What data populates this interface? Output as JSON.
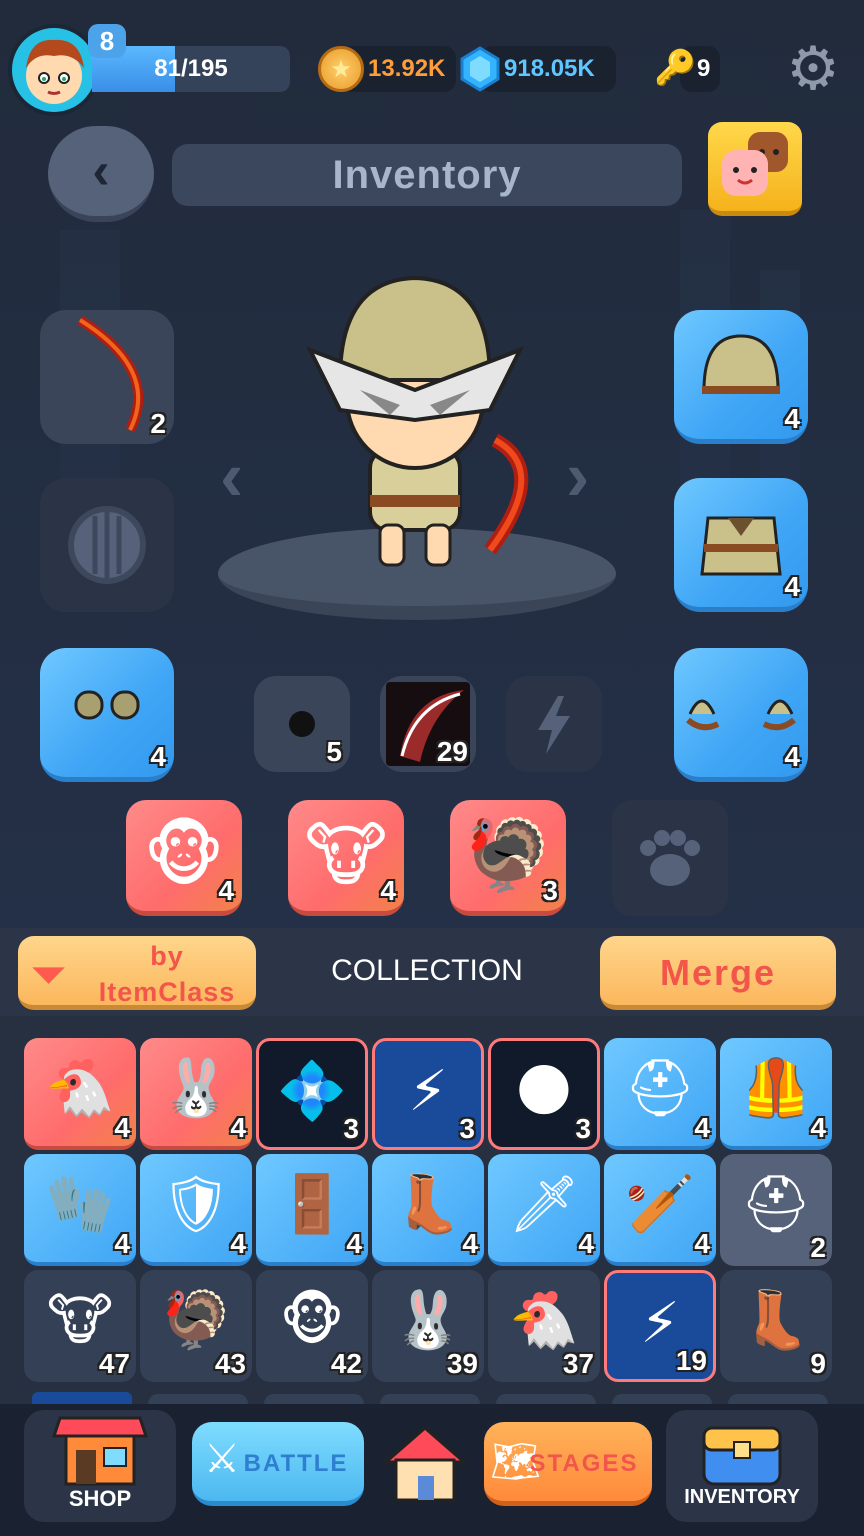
{
  "header": {
    "level": "8",
    "xp_text": "81/195",
    "xp_progress": 0.42,
    "coins": "13.92K",
    "gems": "918.05K",
    "keys": "9",
    "icons": {
      "avatar": "player-avatar",
      "coin": "star-coin-icon",
      "gem": "blue-gem-icon",
      "key": "key-icon",
      "settings": "gear-icon"
    }
  },
  "title": {
    "back_icon": "‹",
    "text": "Inventory"
  },
  "equipment": {
    "weapon_count": "2",
    "helmet_count": "4",
    "armor_count": "4",
    "boots_count": "4",
    "gloves_count": "4",
    "ring_count": "5",
    "skill_count": "29"
  },
  "pets": [
    {
      "name": "monkey",
      "count": "4",
      "icon": "🐵"
    },
    {
      "name": "bull",
      "count": "4",
      "icon": "🐮"
    },
    {
      "name": "turkey",
      "count": "3",
      "icon": "🦃"
    }
  ],
  "collection": {
    "filter_line1": "by",
    "filter_line2": "ItemClass",
    "label": "COLLECTION",
    "merge": "Merge"
  },
  "grid": {
    "row1": [
      {
        "type": "red",
        "icon": "🐔",
        "name": "rooster",
        "count": "4"
      },
      {
        "type": "red",
        "icon": "🐰",
        "name": "rabbit",
        "count": "4"
      },
      {
        "type": "fx",
        "icon": "💠",
        "name": "gem-skill",
        "count": "3"
      },
      {
        "type": "fxb",
        "icon": "⚡",
        "name": "dash-skill",
        "count": "3"
      },
      {
        "type": "fx",
        "icon": "🌑",
        "name": "slash-skill",
        "count": "3"
      },
      {
        "type": "blue",
        "icon": "⛑",
        "name": "helmet",
        "count": "4"
      },
      {
        "type": "blue",
        "icon": "🦺",
        "name": "armor",
        "count": "4"
      }
    ],
    "row2": [
      {
        "type": "blue",
        "icon": "🧤",
        "name": "gloves",
        "count": "4"
      },
      {
        "type": "blue",
        "icon": "🛡",
        "name": "round-shield",
        "count": "4"
      },
      {
        "type": "blue",
        "icon": "🚪",
        "name": "square-shield",
        "count": "4"
      },
      {
        "type": "blue",
        "icon": "👢",
        "name": "boots",
        "count": "4"
      },
      {
        "type": "blue",
        "icon": "🗡",
        "name": "sword",
        "count": "4"
      },
      {
        "type": "blue",
        "icon": "🏏",
        "name": "club",
        "count": "4"
      },
      {
        "type": "gray",
        "icon": "⛑",
        "name": "helmet-gray",
        "count": "2"
      }
    ],
    "row3": [
      {
        "type": "dark",
        "icon": "🐮",
        "name": "bull",
        "count": "47"
      },
      {
        "type": "dark",
        "icon": "🦃",
        "name": "turkey",
        "count": "43"
      },
      {
        "type": "dark",
        "icon": "🐵",
        "name": "monkey",
        "count": "42"
      },
      {
        "type": "dark",
        "icon": "🐰",
        "name": "rabbit",
        "count": "39"
      },
      {
        "type": "dark",
        "icon": "🐔",
        "name": "rooster",
        "count": "37"
      },
      {
        "type": "fxb",
        "icon": "⚡",
        "name": "dash-skill",
        "count": "19"
      },
      {
        "type": "dark",
        "icon": "👢",
        "name": "boots",
        "count": "9"
      }
    ]
  },
  "nav": {
    "shop": "SHOP",
    "battle": "BATTLE",
    "stages": "STAGES",
    "inventory": "INVENTORY"
  },
  "colors": {
    "bg": "#1f2838",
    "slot_blue": "#3fa5f5",
    "slot_red": "#ff6c6c",
    "accent_orange": "#fbb75d",
    "text_red": "#f2554a"
  }
}
